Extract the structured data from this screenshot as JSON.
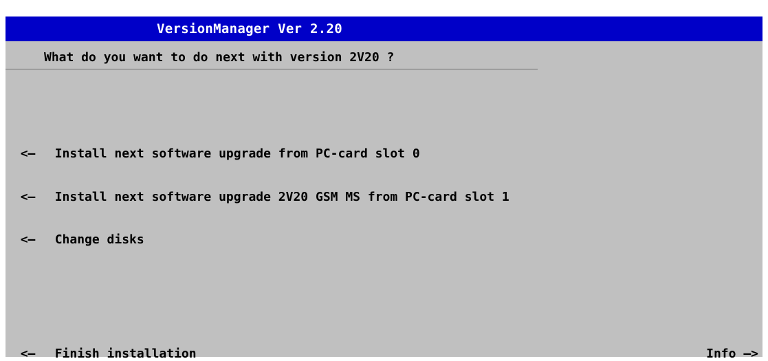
{
  "window": {
    "title": "VersionManager Ver 2.20"
  },
  "prompt": {
    "question": "What do you want to do next with version 2V20 ?"
  },
  "softkeys_left": [
    {
      "arrow": "<—",
      "label": "Install next software upgrade from PC-card slot 0"
    },
    {
      "arrow": "<—",
      "label": "Install next software upgrade 2V20 GSM MS from PC-card slot 1"
    },
    {
      "arrow": "<—",
      "label": "Change disks"
    },
    {
      "arrow": "<—",
      "label": "Finish installation"
    }
  ],
  "softkey_right": {
    "label": "Info",
    "arrow": "—>"
  },
  "colors": {
    "titlebar": "#0000c8",
    "background": "#c0c0c0",
    "text": "#000000",
    "title_text": "#ffffff"
  }
}
